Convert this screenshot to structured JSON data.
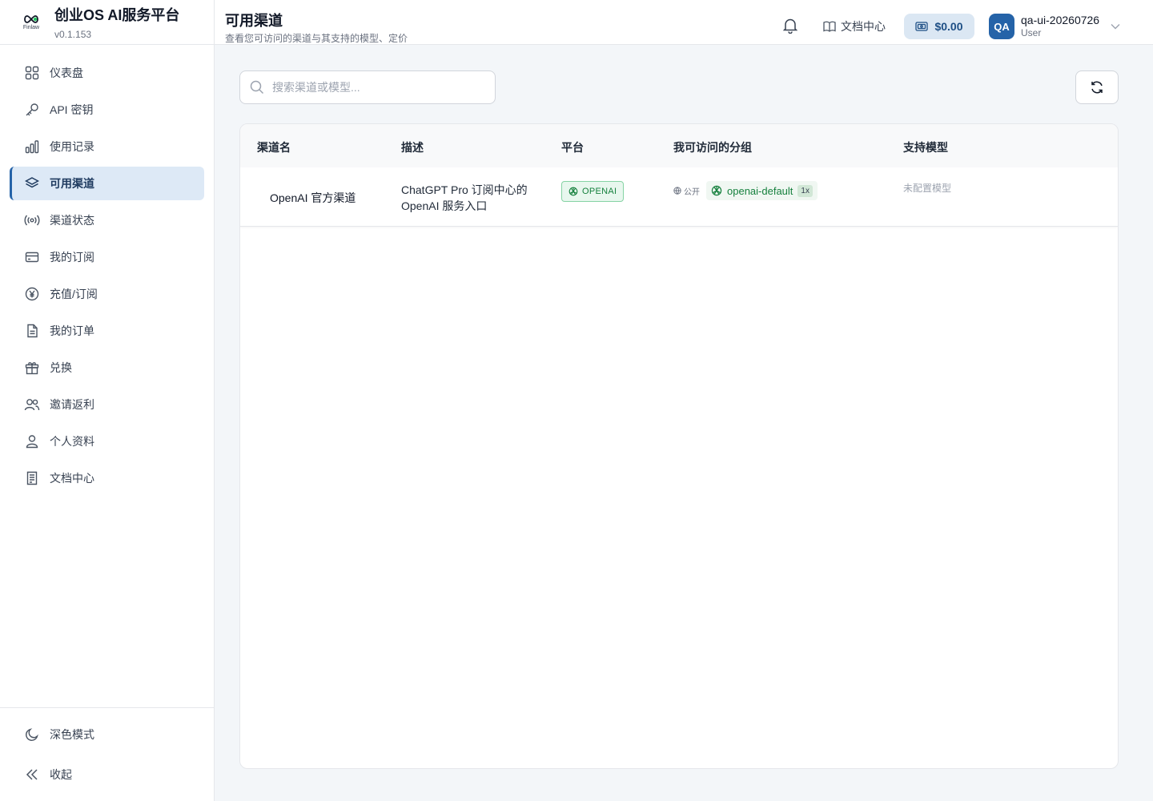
{
  "brand": {
    "logo_text": "Finlaw",
    "title": "创业OS AI服务平台",
    "version": "v0.1.153"
  },
  "sidebar": {
    "items": [
      {
        "label": "仪表盘",
        "icon": "dashboard-icon",
        "active": false
      },
      {
        "label": "API 密钥",
        "icon": "key-icon",
        "active": false
      },
      {
        "label": "使用记录",
        "icon": "bar-chart-icon",
        "active": false
      },
      {
        "label": "可用渠道",
        "icon": "layers-icon",
        "active": true
      },
      {
        "label": "渠道状态",
        "icon": "broadcast-icon",
        "active": false
      },
      {
        "label": "我的订阅",
        "icon": "credit-card-icon",
        "active": false
      },
      {
        "label": "充值/订阅",
        "icon": "yen-icon",
        "active": false
      },
      {
        "label": "我的订单",
        "icon": "document-icon",
        "active": false
      },
      {
        "label": "兑换",
        "icon": "gift-icon",
        "active": false
      },
      {
        "label": "邀请返利",
        "icon": "users-icon",
        "active": false
      },
      {
        "label": "个人资料",
        "icon": "user-icon",
        "active": false
      },
      {
        "label": "文档中心",
        "icon": "book-icon",
        "active": false
      }
    ],
    "dark_mode_label": "深色模式",
    "collapse_label": "收起"
  },
  "header": {
    "title": "可用渠道",
    "subtitle": "查看您可访问的渠道与其支持的模型、定价",
    "docs_label": "文档中心",
    "balance": "$0.00",
    "user": {
      "initials": "QA",
      "name": "qa-ui-20260726",
      "role": "User"
    }
  },
  "search": {
    "placeholder": "搜索渠道或模型...",
    "value": ""
  },
  "table": {
    "headers": [
      "渠道名",
      "描述",
      "平台",
      "我可访问的分组",
      "支持模型"
    ],
    "rows": [
      {
        "name": "OpenAI 官方渠道",
        "description": "ChatGPT Pro 订阅中心的 OpenAI 服务入口",
        "platform": "OPENAI",
        "visibility": "公开",
        "group": "openai-default",
        "ratio": "1x",
        "models": "未配置模型"
      }
    ]
  },
  "colors": {
    "accent": "#2563a8",
    "active_bg": "#dde9f6",
    "success": "#15803d",
    "balance_bg": "#dbe7f3"
  }
}
